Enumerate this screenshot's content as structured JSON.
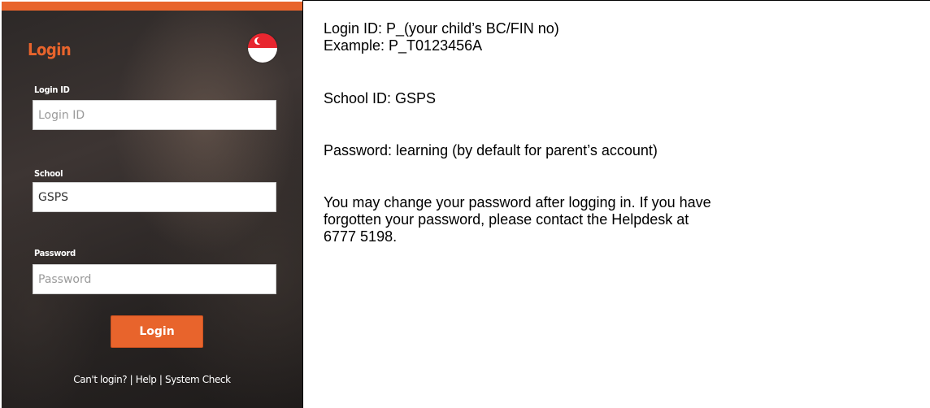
{
  "login_panel": {
    "title": "Login",
    "flag_icon": "singapore-flag-icon",
    "accent_color": "#e8642c",
    "fields": {
      "login_id": {
        "label": "Login ID",
        "placeholder": "Login ID",
        "value": ""
      },
      "school": {
        "label": "School",
        "placeholder": "",
        "value": "GSPS"
      },
      "password": {
        "label": "Password",
        "placeholder": "Password",
        "value": ""
      }
    },
    "login_button": "Login",
    "links": {
      "cant_login": "Can't login?",
      "help": "Help",
      "system_check": "System Check",
      "separator": " | "
    }
  },
  "instructions": {
    "login_id_line": "Login ID: P_(your child’s BC/FIN no)",
    "example_line": "Example: P_T0123456A",
    "school_id_line": "School ID: GSPS",
    "password_line": "Password: learning (by default for parent’s account)",
    "change_line_1": "You may change your password after logging in. If you have",
    "change_line_2": "forgotten your password, please contact the Helpdesk at",
    "change_line_3": "6777 5198."
  }
}
